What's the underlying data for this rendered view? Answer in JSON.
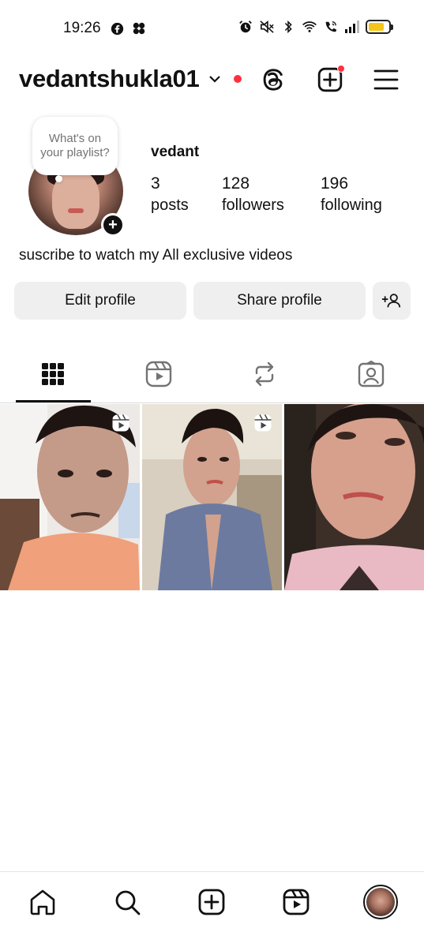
{
  "status_bar": {
    "time": "19:26",
    "left_icons": [
      "facebook-icon",
      "pinwheel-app-icon"
    ],
    "right_icons": [
      "alarm-icon",
      "mute-icon",
      "bluetooth-icon",
      "wifi-icon",
      "wifi-calling-icon",
      "signal-icon"
    ],
    "battery_color": "#f5c518",
    "battery_level": 0.8
  },
  "header": {
    "username": "vedantshukla01",
    "live_dot_color": "#ff3040",
    "icons": [
      "threads-icon",
      "create-post-icon",
      "menu-icon"
    ]
  },
  "profile": {
    "note": "What's on your playlist?",
    "display_name": "vedant",
    "stats": [
      {
        "value": "3",
        "label": "posts"
      },
      {
        "value": "128",
        "label": "followers"
      },
      {
        "value": "196",
        "label": "following"
      }
    ],
    "bio": "suscribe to watch my All exclusive videos"
  },
  "actions": {
    "edit_label": "Edit profile",
    "share_label": "Share profile",
    "discover_icon": "add-person-icon"
  },
  "tabs": [
    {
      "icon": "grid-icon",
      "active": true
    },
    {
      "icon": "reels-icon",
      "active": false
    },
    {
      "icon": "reposts-icon",
      "active": false
    },
    {
      "icon": "tagged-icon",
      "active": false
    }
  ],
  "posts": [
    {
      "type": "reel",
      "shirt_color": "#f0a07a"
    },
    {
      "type": "reel",
      "shirt_color": "#6d7aa0"
    },
    {
      "type": "photo",
      "shirt_color": "#e9b9c4"
    }
  ],
  "bottom_nav": [
    "home-icon",
    "search-icon",
    "create-icon",
    "reels-icon",
    "profile-avatar"
  ]
}
